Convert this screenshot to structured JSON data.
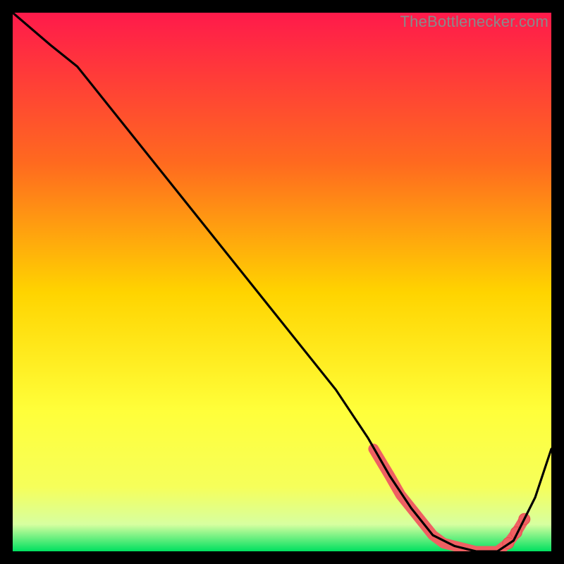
{
  "watermark": "TheBottlenecker.com",
  "colors": {
    "frame": "#000000",
    "grad_top": "#ff1a4b",
    "grad_upper_mid": "#ff6a1f",
    "grad_mid": "#ffd400",
    "grad_lower_mid": "#f6ff5a",
    "grad_low": "#d7ffa0",
    "grad_bottom": "#00e060",
    "curve": "#000000",
    "marker_fill": "#ef6062",
    "marker_stroke": "#e84a4d"
  },
  "chart_data": {
    "type": "line",
    "title": "",
    "xlabel": "",
    "ylabel": "",
    "xlim": [
      0,
      100
    ],
    "ylim": [
      0,
      100
    ],
    "series": [
      {
        "name": "bottleneck-curve",
        "x": [
          0,
          7,
          12,
          20,
          30,
          40,
          50,
          60,
          66,
          70,
          74,
          78,
          82,
          86,
          90,
          93,
          97,
          100
        ],
        "y": [
          100,
          94,
          90,
          80,
          67.5,
          55,
          42.5,
          30,
          21,
          14,
          8,
          3,
          1,
          0,
          0,
          2,
          10,
          19
        ]
      }
    ],
    "markers": {
      "name": "highlighted-range",
      "x": [
        67,
        70,
        72,
        74,
        76,
        78,
        80,
        82,
        84,
        86,
        88,
        90,
        92,
        93.5,
        95
      ],
      "y": [
        19,
        14,
        10.5,
        8,
        5.5,
        3,
        1.5,
        1,
        0.5,
        0,
        0,
        0,
        1.5,
        3.5,
        6
      ]
    }
  }
}
